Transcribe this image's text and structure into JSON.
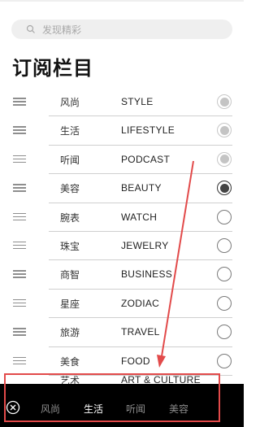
{
  "search": {
    "placeholder": "发现精彩"
  },
  "page_title": "订阅栏目",
  "items": [
    {
      "cn": "风尚",
      "en": "STYLE",
      "state": "disabled"
    },
    {
      "cn": "生活",
      "en": "LIFESTYLE",
      "state": "disabled"
    },
    {
      "cn": "听闻",
      "en": "PODCAST",
      "state": "disabled"
    },
    {
      "cn": "美容",
      "en": "BEAUTY",
      "state": "selected"
    },
    {
      "cn": "腕表",
      "en": "WATCH",
      "state": "empty"
    },
    {
      "cn": "珠宝",
      "en": "JEWELRY",
      "state": "empty"
    },
    {
      "cn": "商智",
      "en": "BUSINESS",
      "state": "empty"
    },
    {
      "cn": "星座",
      "en": "ZODIAC",
      "state": "empty"
    },
    {
      "cn": "旅游",
      "en": "TRAVEL",
      "state": "empty"
    },
    {
      "cn": "美食",
      "en": "FOOD",
      "state": "empty"
    }
  ],
  "partial_item": {
    "cn": "艺术",
    "en": "ART & CULTURE"
  },
  "bottom_tabs": [
    {
      "label": "风尚",
      "active": false
    },
    {
      "label": "生活",
      "active": true
    },
    {
      "label": "听闻",
      "active": false
    },
    {
      "label": "美容",
      "active": false
    }
  ],
  "colors": {
    "annotation": "#e24a4a",
    "bottom_bar": "#000000"
  }
}
